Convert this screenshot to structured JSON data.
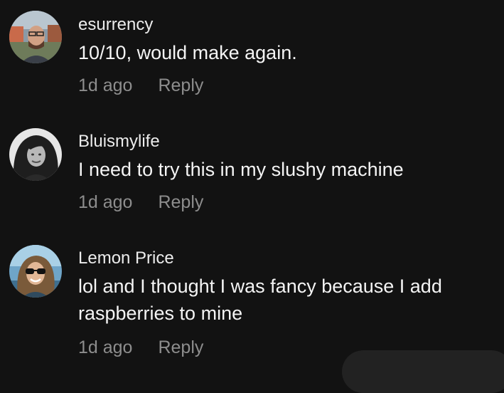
{
  "comments": [
    {
      "username": "esurrency",
      "text": "10/10, would make again.",
      "time": "1d ago",
      "reply_label": "Reply"
    },
    {
      "username": "Bluismylife",
      "text": "I need to try this in my slushy machine",
      "time": "1d ago",
      "reply_label": "Reply"
    },
    {
      "username": "Lemon Price",
      "text": "lol and I thought I was fancy because I add raspberries to mine",
      "time": "1d ago",
      "reply_label": "Reply"
    }
  ],
  "colors": {
    "background": "#121212",
    "text": "#f4f4f4",
    "muted": "#8d8d8d"
  }
}
